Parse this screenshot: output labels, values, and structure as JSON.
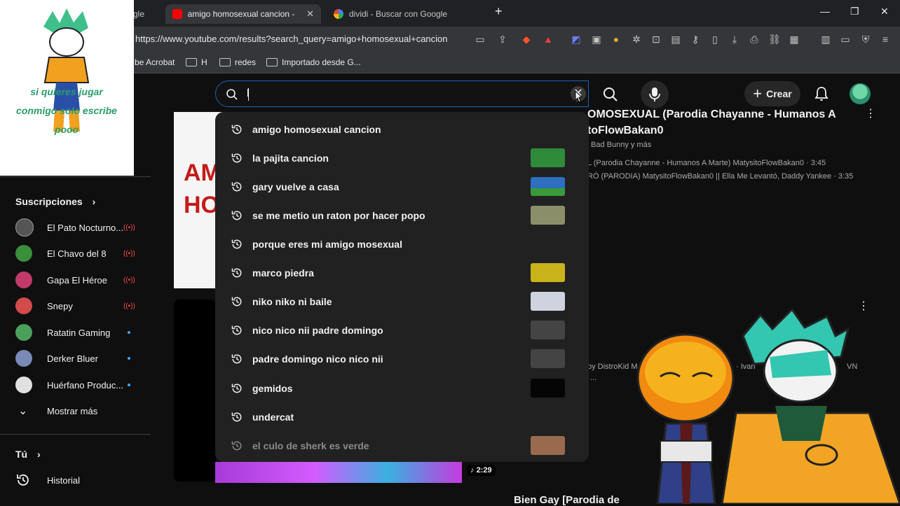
{
  "browser": {
    "tabs": [
      {
        "label": "gle"
      },
      {
        "label": "amigo homosexual cancion - Yo"
      },
      {
        "label": "dividi - Buscar con Google"
      }
    ],
    "url": "https://www.youtube.com/results?search_query=amigo+homosexual+cancion",
    "bookmarks": [
      "be Acrobat",
      "H",
      "redes",
      "Importado desde G..."
    ]
  },
  "youtube": {
    "search_value": "l",
    "create_label": "Crear",
    "suggestions": [
      {
        "text": "amigo homosexual cancion",
        "thumb": ""
      },
      {
        "text": "la pajita cancion",
        "thumb": "#2e8b3a"
      },
      {
        "text": "gary vuelve a casa",
        "thumb": "#2e6fbf"
      },
      {
        "text": "se me metio un raton por hacer popo",
        "thumb": "#8a8f6a"
      },
      {
        "text": "porque eres mi amigo mosexual",
        "thumb": ""
      },
      {
        "text": "marco piedra",
        "thumb": "#c9b31b"
      },
      {
        "text": "niko niko ni baile",
        "thumb": "#cfd3e0"
      },
      {
        "text": "nico nico nii padre domingo",
        "thumb": "#444444"
      },
      {
        "text": "padre domingo nico nico nii",
        "thumb": "#444444"
      },
      {
        "text": "gemidos",
        "thumb": "#050505"
      },
      {
        "text": "undercat",
        "thumb": ""
      },
      {
        "text": "el culo de sherk es verde",
        "thumb": "#9a6a4f"
      }
    ],
    "sidebar": {
      "subscriptions_label": "Suscripciones",
      "subscriptions": [
        {
          "name": "El Pato Nocturno...",
          "status": "live",
          "color": "#555555"
        },
        {
          "name": "El Chavo del 8",
          "status": "live",
          "color": "#3a8f3a"
        },
        {
          "name": "Gapa El Héroe",
          "status": "live",
          "color": "#c23a6a"
        },
        {
          "name": "Snepy",
          "status": "live",
          "color": "#d24a4a"
        },
        {
          "name": "Ratatin Gaming",
          "status": "new",
          "color": "#4aa05a"
        },
        {
          "name": "Derker Bluer",
          "status": "new",
          "color": "#7a8ab8"
        },
        {
          "name": "Huérfano Produc...",
          "status": "new",
          "color": "#e0e0e0"
        }
      ],
      "show_more": "Mostrar más",
      "you_label": "Tú",
      "history_label": "Historial"
    },
    "results": {
      "top_title_line1": "OMOSEXUAL (Parodia Chayanne - Humanos A",
      "top_title_line2": "toFlowBakan0",
      "top_meta": "Bad Bunny y más",
      "top_sub1": "L (Parodia Chayanne - Humanos A Marte) MatysitoFlowBakan0 · 3:45",
      "top_sub2": "RÓ (PARODIA) MatysitoFlowBakan0 || Ella Me Levantó, Daddy Yankee · 3:35",
      "mid_meta_left": "by DistroKid M",
      "mid_meta_right1": "· Ivan",
      "mid_meta_right2": "VN",
      "mid_ellipsis": "...",
      "card_text_1": "AM",
      "card_text_2": "HO",
      "duration": "2:29",
      "bottom_title": "Bien Gay [Parodia de"
    }
  },
  "overlay": {
    "sticker_text": "si quieres jugar conmigo solo escribe pooo"
  }
}
